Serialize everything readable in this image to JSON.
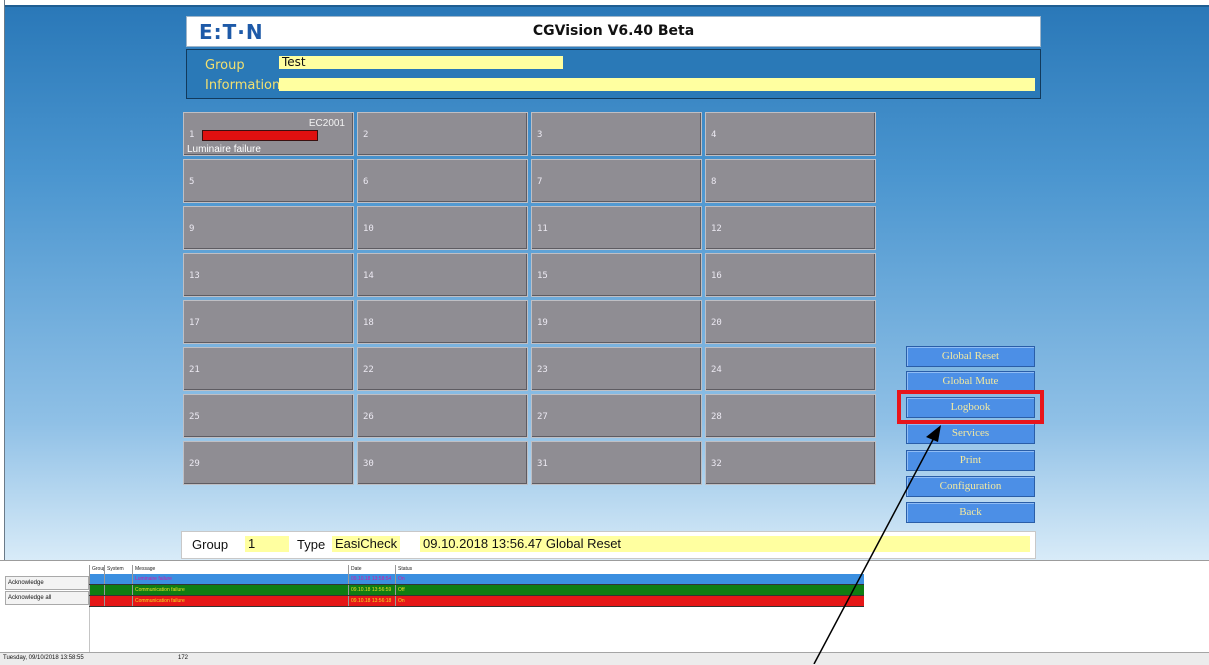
{
  "header": {
    "logo": "E:T·N",
    "title": "CGVision V6.40 Beta"
  },
  "group_box": {
    "group_label": "Group",
    "group_value": "Test",
    "information_label": "Information",
    "information_value": ""
  },
  "grid": {
    "cells": [
      {
        "num": "1",
        "device": "EC2001",
        "fault": "Luminaire failure",
        "alarm": true
      },
      {
        "num": "2"
      },
      {
        "num": "3"
      },
      {
        "num": "4"
      },
      {
        "num": "5"
      },
      {
        "num": "6"
      },
      {
        "num": "7"
      },
      {
        "num": "8"
      },
      {
        "num": "9"
      },
      {
        "num": "10"
      },
      {
        "num": "11"
      },
      {
        "num": "12"
      },
      {
        "num": "13"
      },
      {
        "num": "14"
      },
      {
        "num": "15"
      },
      {
        "num": "16"
      },
      {
        "num": "17"
      },
      {
        "num": "18"
      },
      {
        "num": "19"
      },
      {
        "num": "20"
      },
      {
        "num": "21"
      },
      {
        "num": "22"
      },
      {
        "num": "23"
      },
      {
        "num": "24"
      },
      {
        "num": "25"
      },
      {
        "num": "26"
      },
      {
        "num": "27"
      },
      {
        "num": "28"
      },
      {
        "num": "29"
      },
      {
        "num": "30"
      },
      {
        "num": "31"
      },
      {
        "num": "32"
      }
    ]
  },
  "buttons": {
    "global_reset": "Global Reset",
    "global_mute": "Global Mute",
    "logbook": "Logbook",
    "services": "Services",
    "print": "Print",
    "configuration": "Configuration",
    "back": "Back"
  },
  "status": {
    "group_label": "Group",
    "group_value": "1",
    "type_label": "Type",
    "type_value": "EasiCheck",
    "event": "09.10.2018 13:56.47  Global Reset"
  },
  "messages": {
    "headers": {
      "group": "Group",
      "system": "System",
      "message": "Message",
      "date": "Date",
      "status": "Status"
    },
    "rows": [
      {
        "message": "Luminaire failure",
        "date": "09.10.18 13:58:54",
        "status": "On",
        "bg": "#3b8fe0",
        "fg": "#d11aa8"
      },
      {
        "message": "Communication failure",
        "date": "09.10.18 13:56:59",
        "status": "Off",
        "bg": "#0f7d12",
        "fg": "#f0e020"
      },
      {
        "message": "Communication failure",
        "date": "09.10.18 13:56:18",
        "status": "On",
        "bg": "#e51717",
        "fg": "#f0e020"
      }
    ]
  },
  "actions": {
    "acknowledge": "Acknowledge",
    "acknowledge_all": "Acknowledge all"
  },
  "footer": {
    "datetime": "Tuesday, 09/10/2018 13:58:55",
    "count": "172"
  },
  "colors": {
    "highlight": "#e8151b",
    "alarm": "#e01010",
    "button": "#4c8fe6"
  }
}
